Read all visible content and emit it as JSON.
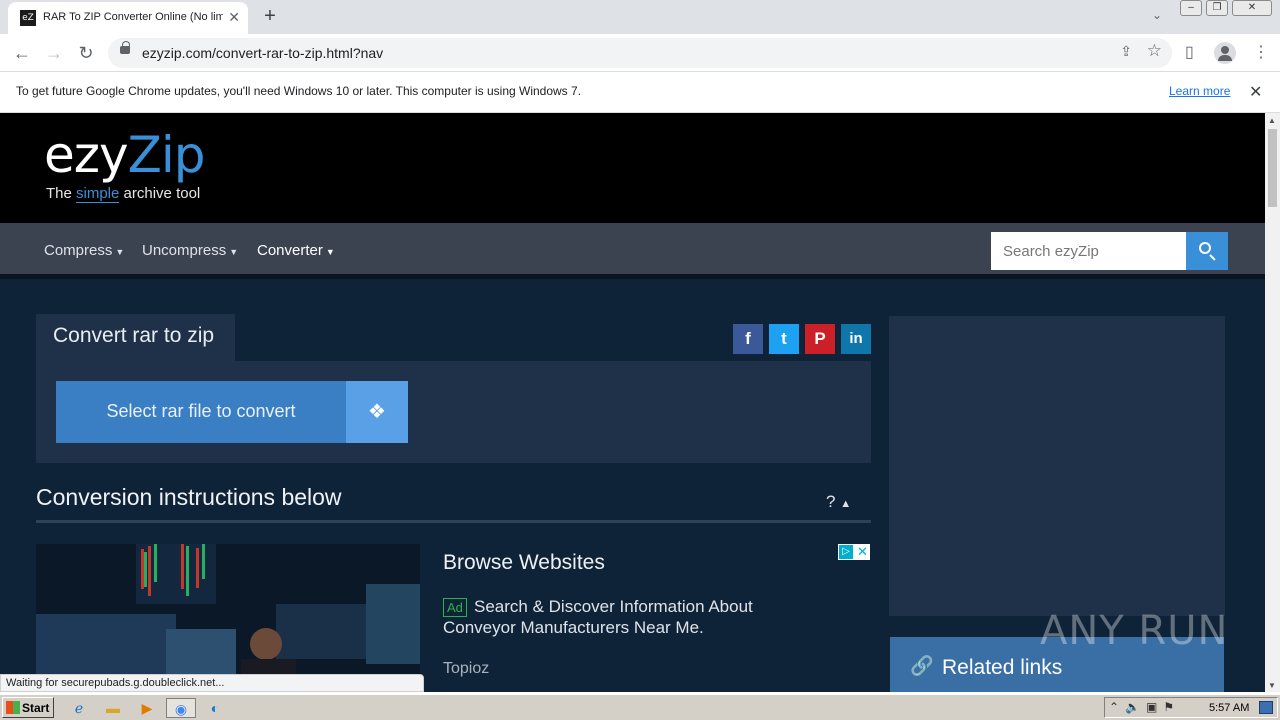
{
  "browser": {
    "tab_title": "RAR To ZIP Converter Online (No lim",
    "tab_favicon": "eZ",
    "url": "ezyzip.com/convert-rar-to-zip.html?nav",
    "infobar_message": "To get future Google Chrome updates, you'll need Windows 10 or later. This computer is using Windows 7.",
    "infobar_link": "Learn more",
    "status_text": "Waiting for securepubads.g.doubleclick.net..."
  },
  "site": {
    "logo_main": "ezy",
    "logo_z": "Zip",
    "tagline_pre": "The ",
    "tagline_simple": "simple",
    "tagline_post": " archive tool",
    "nav": {
      "compress": "Compress",
      "uncompress": "Uncompress",
      "converter": "Converter"
    },
    "search_placeholder": "Search ezyZip"
  },
  "converter": {
    "tab_label": "Convert rar to zip",
    "select_button": "Select rar file to convert",
    "social": [
      "f",
      "t",
      "P",
      "in"
    ]
  },
  "instructions": {
    "title": "Conversion instructions below",
    "help": "?"
  },
  "ad": {
    "title": "Browse Websites",
    "badge": "Ad",
    "text": "Search & Discover Information About Conveyor Manufacturers Near Me.",
    "source": "Topioz"
  },
  "sidebar": {
    "related_links": "Related links"
  },
  "watermark": "ANY RUN",
  "taskbar": {
    "start": "Start",
    "clock": "5:57 AM"
  },
  "colors": {
    "accent": "#3a8fd9",
    "page_bg": "#0f2338",
    "panel_bg": "#1e3148",
    "nav_bg": "#3b4250"
  }
}
